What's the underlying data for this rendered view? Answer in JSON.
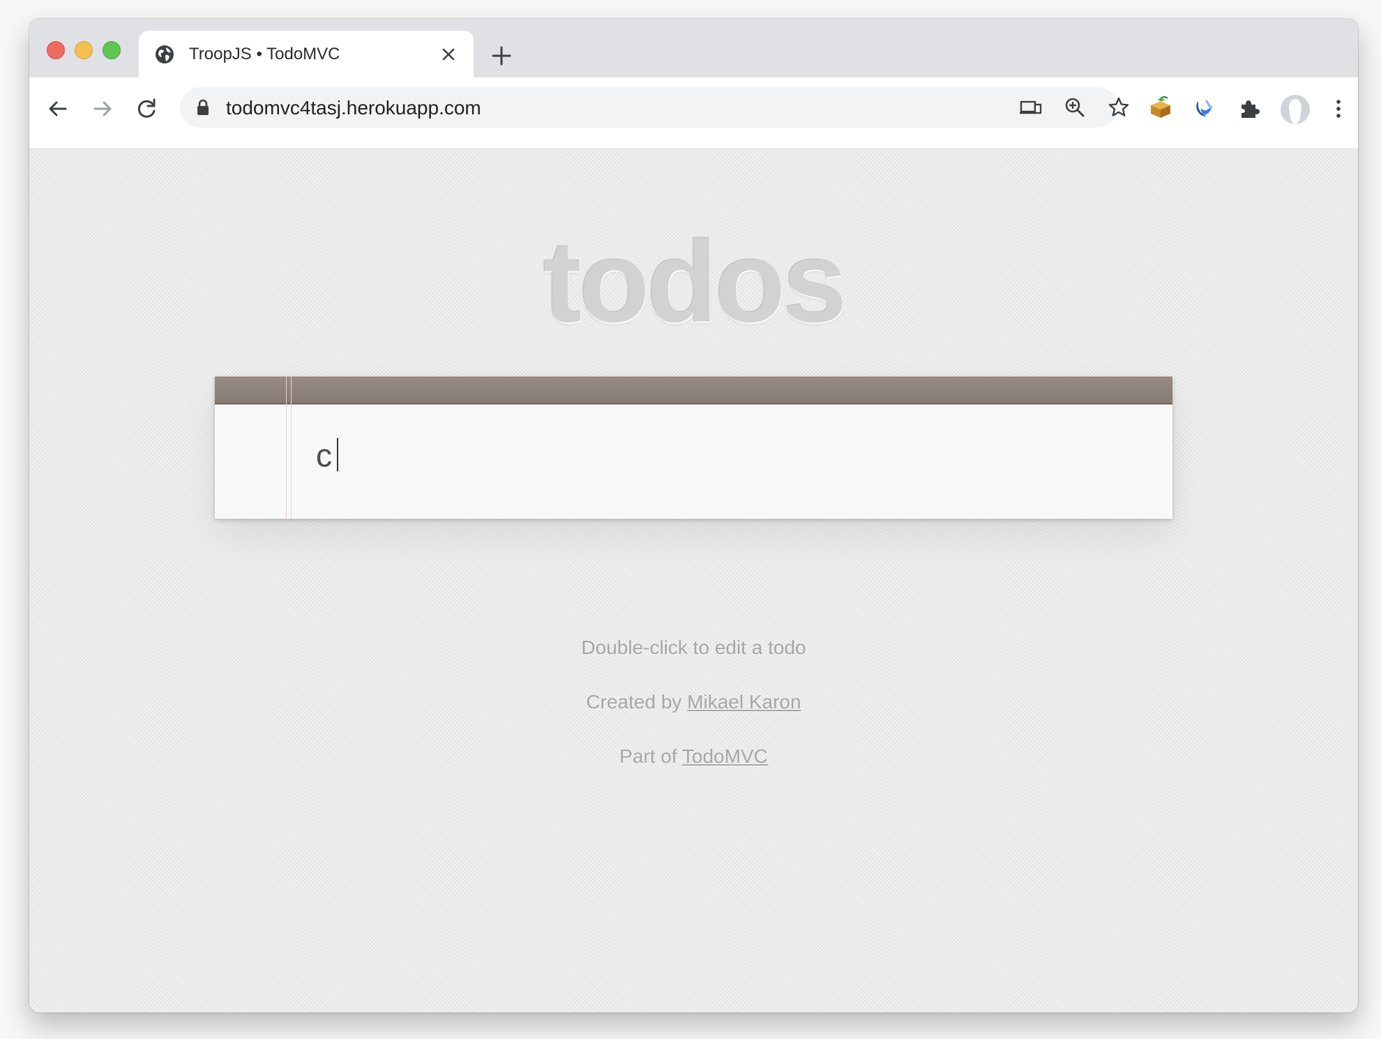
{
  "browser": {
    "tab": {
      "title": "TroopJS • TodoMVC",
      "favicon": "globe-icon"
    },
    "address_bar": {
      "url": "todomvc4tasj.herokuapp.com"
    },
    "colors": {
      "tabstrip": "#dfe1e5",
      "close": "#ed6a5e",
      "minimize": "#f5bf4f",
      "zoom": "#61c554"
    }
  },
  "app": {
    "title": "todos",
    "new_todo": {
      "value": "c",
      "placeholder": ""
    },
    "header_bar_color": "#8b7f79",
    "footer": {
      "hint": "Double-click to edit a todo",
      "created_prefix": "Created by ",
      "created_link": "Mikael Karon",
      "part_prefix": "Part of ",
      "part_link": "TodoMVC"
    }
  }
}
